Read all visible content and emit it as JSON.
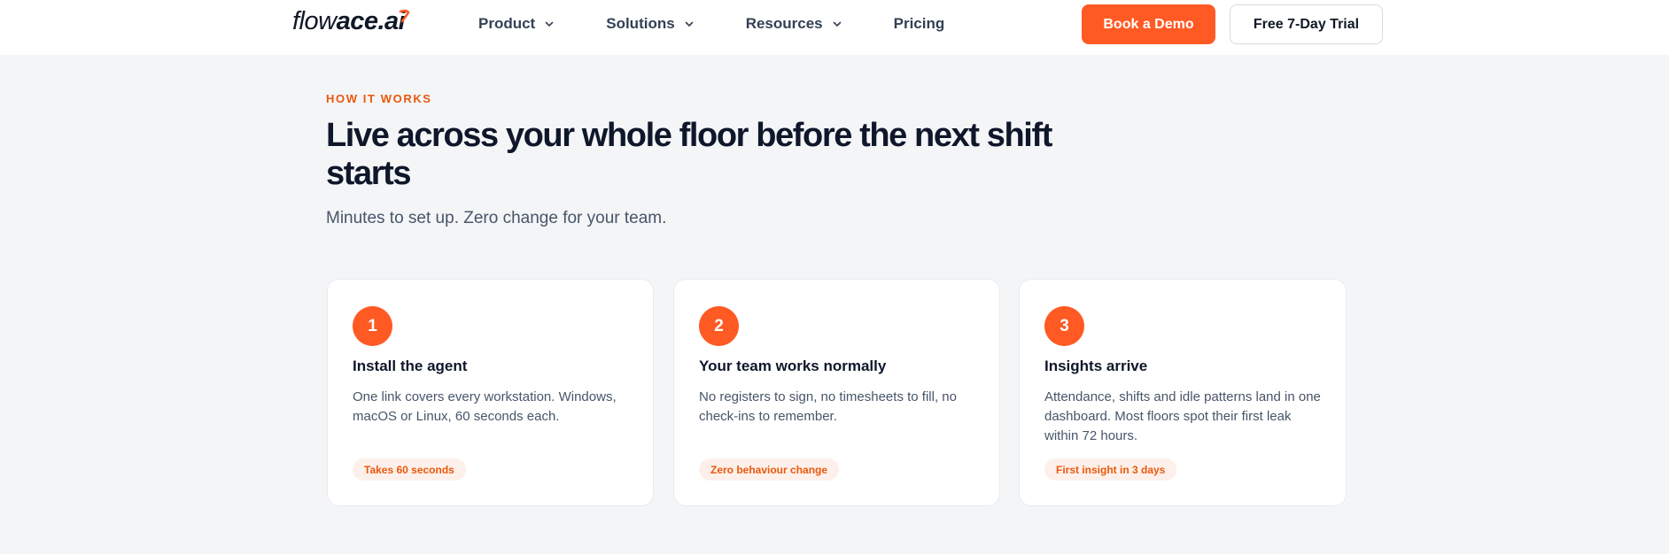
{
  "header": {
    "logo": {
      "light": "flow",
      "bold": "ace.ai"
    },
    "nav": [
      {
        "label": "Product",
        "icon": "chevron-down-icon"
      },
      {
        "label": "Solutions",
        "icon": "chevron-down-icon"
      },
      {
        "label": "Resources",
        "icon": "chevron-down-icon"
      },
      {
        "label": "Pricing"
      }
    ],
    "book_demo_label": "Book a Demo",
    "free_trial_label": "Free 7-Day Trial"
  },
  "hero": {
    "eyebrow": "HOW IT WORKS",
    "title": "Live across your whole floor before the next shift starts",
    "subtitle": "Minutes to set up. Zero change for your team."
  },
  "steps": [
    {
      "number": "1",
      "title": "Install the agent",
      "text": "One link covers every workstation. Windows, macOS or Linux, 60 seconds each.",
      "badge": "Takes 60 seconds"
    },
    {
      "number": "2",
      "title": "Your team works normally",
      "text": "No registers to sign, no timesheets to fill, no check-ins to remember.",
      "badge": "Zero behaviour change"
    },
    {
      "number": "3",
      "title": "Insights arrive",
      "text": "Attendance, shifts and idle patterns land in one dashboard. Most floors spot their first leak within 72 hours.",
      "badge": "First insight in 3 days"
    }
  ],
  "colors": {
    "accent": "#ff5a24",
    "accent_text": "#ea580c",
    "badge_bg": "#fdf0ea",
    "page_bg": "#f4f5f7",
    "heading": "#0f172a",
    "body_text": "#475569"
  }
}
